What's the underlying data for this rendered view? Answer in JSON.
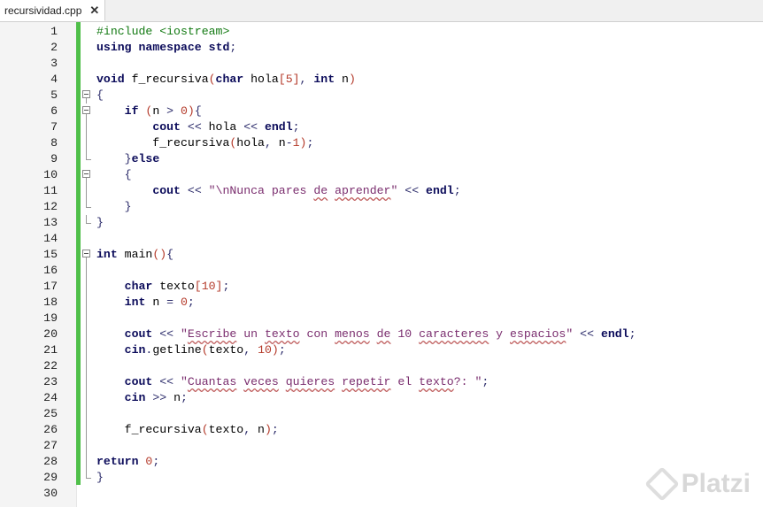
{
  "tab": {
    "title": "recursividad.cpp",
    "close": "✕"
  },
  "editor": {
    "lines": [
      {
        "n": "1",
        "t": "#include <iostream>"
      },
      {
        "n": "2",
        "t": "using namespace std;"
      },
      {
        "n": "3",
        "t": ""
      },
      {
        "n": "4",
        "t": "void f_recursiva(char hola[5], int n)"
      },
      {
        "n": "5",
        "t": "{"
      },
      {
        "n": "6",
        "t": "    if (n > 0){"
      },
      {
        "n": "7",
        "t": "        cout << hola << endl;"
      },
      {
        "n": "8",
        "t": "        f_recursiva(hola, n-1);"
      },
      {
        "n": "9",
        "t": "    }else"
      },
      {
        "n": "10",
        "t": "    {"
      },
      {
        "n": "11",
        "t": "        cout << \"\\nNunca pares de aprender\" << endl;"
      },
      {
        "n": "12",
        "t": "    }"
      },
      {
        "n": "13",
        "t": "}"
      },
      {
        "n": "14",
        "t": ""
      },
      {
        "n": "15",
        "t": "int main(){"
      },
      {
        "n": "16",
        "t": ""
      },
      {
        "n": "17",
        "t": "    char texto[10];"
      },
      {
        "n": "18",
        "t": "    int n = 0;"
      },
      {
        "n": "19",
        "t": ""
      },
      {
        "n": "20",
        "t": "    cout << \"Escribe un texto con menos de 10 caracteres y espacios\" << endl;"
      },
      {
        "n": "21",
        "t": "    cin.getline(texto, 10);"
      },
      {
        "n": "22",
        "t": ""
      },
      {
        "n": "23",
        "t": "    cout << \"Cuantas veces quieres repetir el texto?: \";"
      },
      {
        "n": "24",
        "t": "    cin >> n;"
      },
      {
        "n": "25",
        "t": ""
      },
      {
        "n": "26",
        "t": "    f_recursiva(texto, n);"
      },
      {
        "n": "27",
        "t": ""
      },
      {
        "n": "28",
        "t": "return 0;"
      },
      {
        "n": "29",
        "t": "}"
      },
      {
        "n": "30",
        "t": ""
      }
    ]
  },
  "watermark": {
    "text": "Platzi"
  }
}
